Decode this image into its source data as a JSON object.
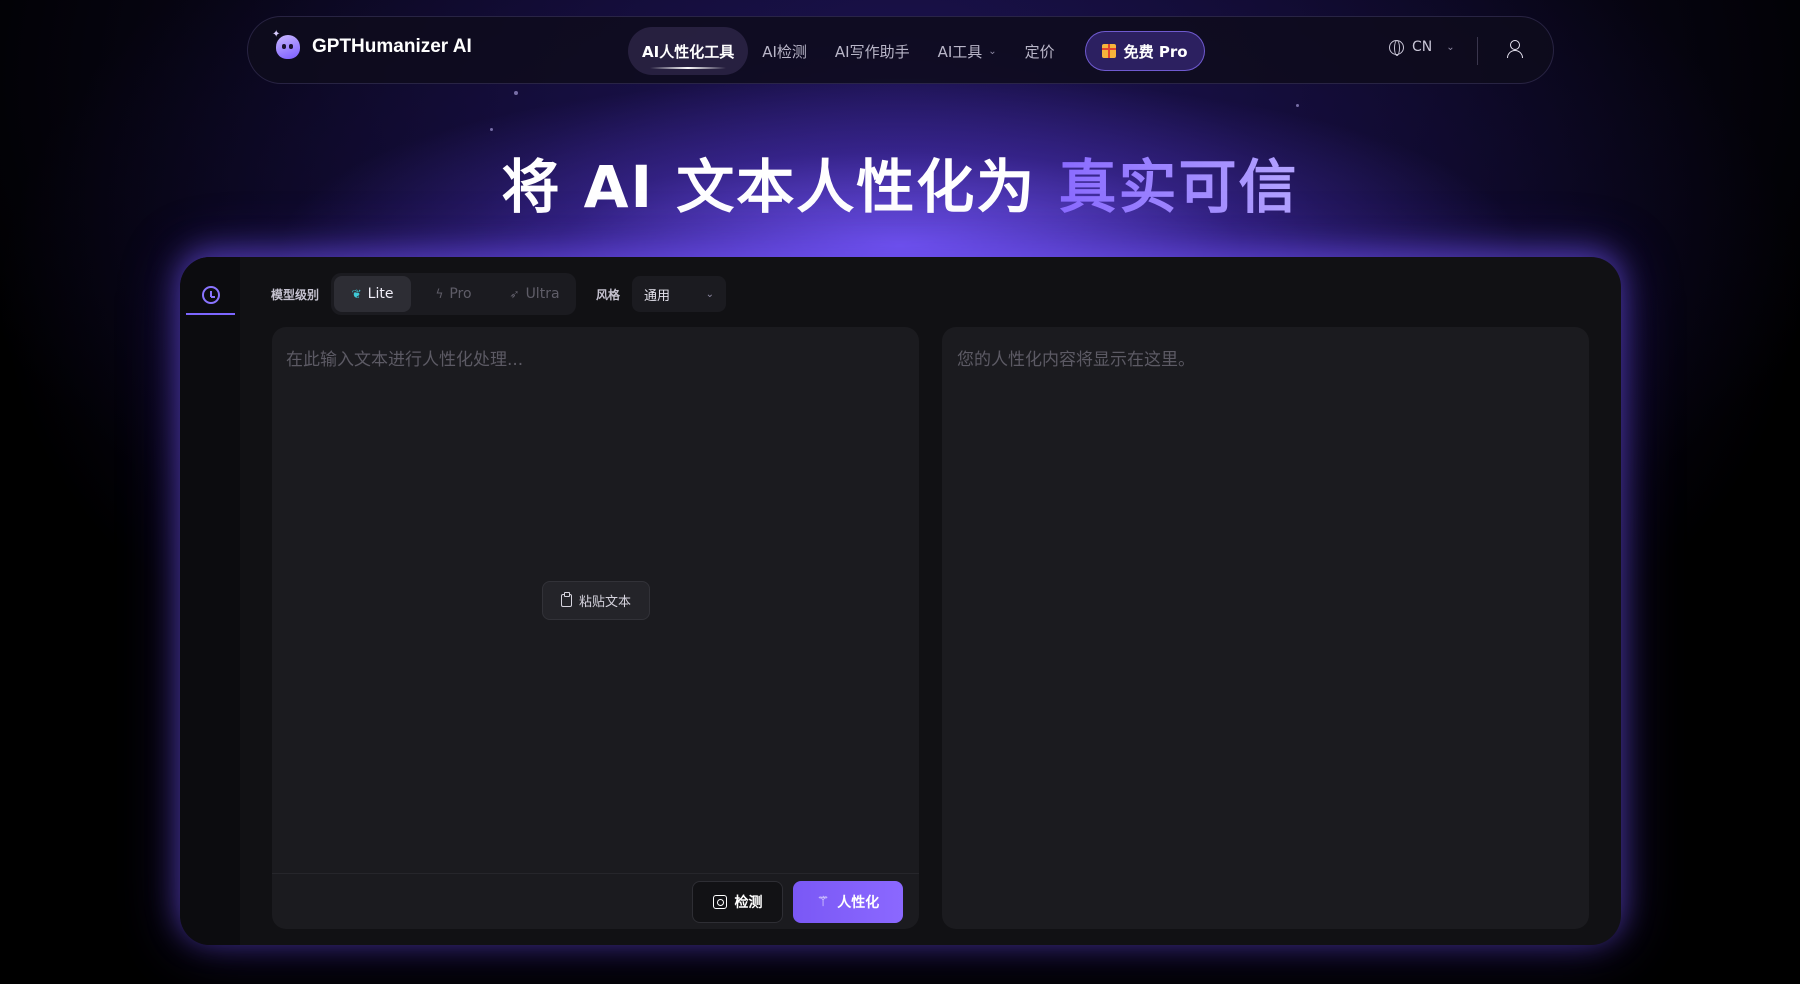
{
  "nav": {
    "brand": "GPTHumanizer AI",
    "items": [
      {
        "label": "AI人性化工具",
        "active": true
      },
      {
        "label": "AI检测",
        "active": false
      },
      {
        "label": "AI写作助手",
        "active": false
      },
      {
        "label": "AI工具",
        "active": false,
        "has_dropdown": true
      },
      {
        "label": "定价",
        "active": false
      }
    ],
    "pro_button": "免费 Pro",
    "language": "CN"
  },
  "hero": {
    "title_main": "将 AI 文本人性化为",
    "title_accent": "真实可信"
  },
  "toolbar": {
    "model_label": "模型级别",
    "models": [
      {
        "label": "Lite",
        "active": true
      },
      {
        "label": "Pro",
        "active": false
      },
      {
        "label": "Ultra",
        "active": false
      }
    ],
    "style_label": "风格",
    "style_value": "通用"
  },
  "input": {
    "placeholder": "在此输入文本进行人性化处理...",
    "paste_label": "粘贴文本",
    "detect_label": "检测",
    "humanize_label": "人性化"
  },
  "output": {
    "placeholder": "您的人性化内容将显示在这里。"
  },
  "colors": {
    "accent": "#7d5cff",
    "accent_text": "#9b86ff",
    "panel_bg": "#111114",
    "box_bg": "#1b1b1f"
  }
}
